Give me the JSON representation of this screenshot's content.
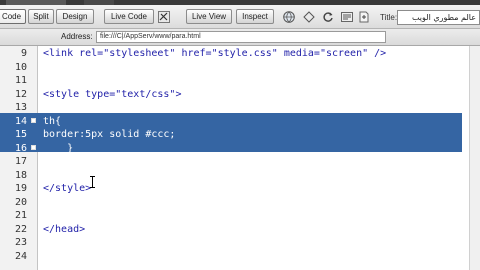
{
  "toolbar": {
    "code_label": "Code",
    "split_label": "Split",
    "design_label": "Design",
    "live_code_label": "Live Code",
    "live_view_label": "Live View",
    "inspect_label": "Inspect",
    "title_label": "Title:",
    "title_value": "عالم مطوري الويب"
  },
  "address": {
    "label": "Address:",
    "value": "file:///C|/AppServ/www/para.html"
  },
  "code_lines": [
    {
      "num": "9",
      "text": "<link rel=\"stylesheet\" href=\"style.css\" media=\"screen\" />"
    },
    {
      "num": "10",
      "text": ""
    },
    {
      "num": "11",
      "text": ""
    },
    {
      "num": "12",
      "text": "<style type=\"text/css\">"
    },
    {
      "num": "13",
      "text": ""
    },
    {
      "num": "14",
      "text": "th{"
    },
    {
      "num": "15",
      "text": "border:5px solid #ccc;"
    },
    {
      "num": "16",
      "text": "    }"
    },
    {
      "num": "17",
      "text": ""
    },
    {
      "num": "18",
      "text": ""
    },
    {
      "num": "19",
      "text": "</style>"
    },
    {
      "num": "20",
      "text": ""
    },
    {
      "num": "21",
      "text": ""
    },
    {
      "num": "22",
      "text": "</head>"
    },
    {
      "num": "23",
      "text": ""
    },
    {
      "num": "24",
      "text": ""
    }
  ],
  "selected_line_numbers": [
    "14",
    "15",
    "16"
  ],
  "colors": {
    "selection": "#3565a3",
    "code_text": "#1f1fa8",
    "gutter_bg": "#f2f2f2"
  },
  "icons": {
    "refresh": "refresh-icon",
    "file_management": "file-management-icon",
    "browser_preview": "browser-preview-icon",
    "debug": "debug-icon",
    "view_options": "view-options-icon",
    "visual_aids": "visual-aids-icon"
  }
}
